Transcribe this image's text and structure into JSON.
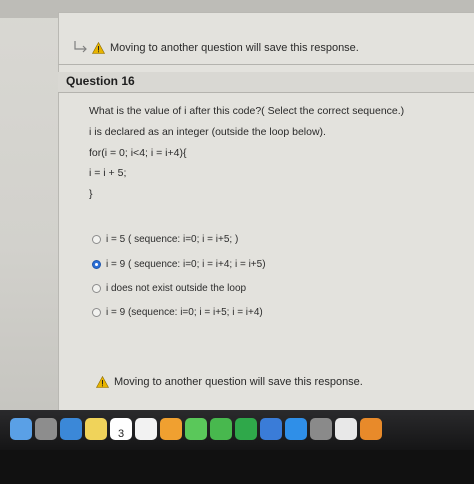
{
  "page": {
    "warning_text": "Moving to another question will save this response.",
    "colors": {
      "warning": "#e8b400",
      "accent": "#2b6fd6"
    }
  },
  "question": {
    "title": "Question 16",
    "prompt": "What is the value of i after this code?( Select the correct sequence.)",
    "line1": "i is declared as an integer (outside the loop below).",
    "code1": "for(i = 0; i<4; i = i+4){",
    "code2": "i = i + 5;",
    "code3": "}"
  },
  "options": [
    {
      "label": "i = 5  ( sequence:  i=0; i = i+5; )",
      "selected": false
    },
    {
      "label": "i = 9 ( sequence:  i=0; i = i+4; i = i+5)",
      "selected": true
    },
    {
      "label": "i does not exist outside the loop",
      "selected": false
    },
    {
      "label": "i = 9 (sequence: i=0; i = i+5; i = i+4)",
      "selected": false
    }
  ],
  "dock": {
    "calendar_day": "3",
    "apps": [
      "finder-icon",
      "launchpad-icon",
      "safari-icon",
      "notes-icon",
      "calendar-icon",
      "reminders-icon",
      "photos-icon",
      "messages-icon",
      "facetime-icon",
      "numbers-icon",
      "keynote-icon",
      "app-store-icon",
      "system-preferences-icon",
      "itunes-icon",
      "ibooks-icon"
    ]
  }
}
